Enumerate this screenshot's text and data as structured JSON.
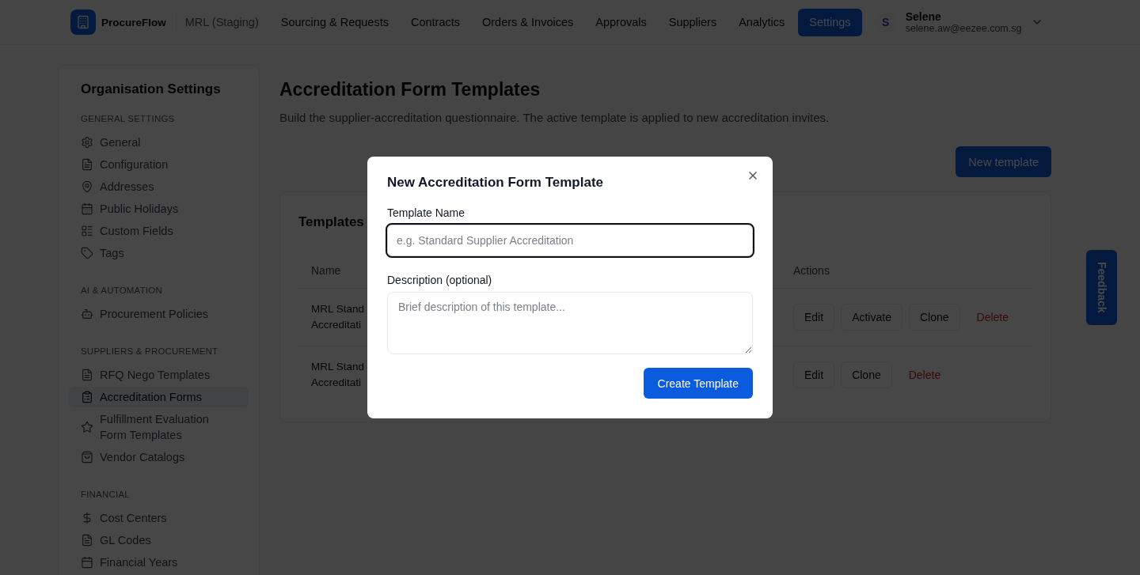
{
  "header": {
    "logo": "ProcureFlow",
    "workspace": "MRL (Staging)",
    "nav": [
      {
        "label": "Sourcing & Requests",
        "selected": false
      },
      {
        "label": "Contracts",
        "selected": false
      },
      {
        "label": "Orders & Invoices",
        "selected": false
      },
      {
        "label": "Approvals",
        "selected": false
      },
      {
        "label": "Suppliers",
        "selected": false
      },
      {
        "label": "Analytics",
        "selected": false
      },
      {
        "label": "Settings",
        "selected": true
      }
    ],
    "user": {
      "initial": "S",
      "name": "Selene",
      "email": "selene.aw@eezee.com.sg"
    }
  },
  "sidebar": {
    "title": "Organisation Settings",
    "sections": [
      {
        "heading": "GENERAL SETTINGS",
        "items": [
          {
            "label": "General",
            "selected": false
          },
          {
            "label": "Configuration",
            "selected": false
          },
          {
            "label": "Addresses",
            "selected": false
          },
          {
            "label": "Public Holidays",
            "selected": false
          },
          {
            "label": "Custom Fields",
            "selected": false
          },
          {
            "label": "Tags",
            "selected": false
          }
        ]
      },
      {
        "heading": "AI & AUTOMATION",
        "items": [
          {
            "label": "Procurement Policies",
            "selected": false
          }
        ]
      },
      {
        "heading": "SUPPLIERS & PROCUREMENT",
        "items": [
          {
            "label": "RFQ Nego Templates",
            "selected": false
          },
          {
            "label": "Accreditation Forms",
            "selected": true
          },
          {
            "label": "Fulfillment Evaluation Form Templates",
            "selected": false
          },
          {
            "label": "Vendor Catalogs",
            "selected": false
          }
        ]
      },
      {
        "heading": "FINANCIAL",
        "items": [
          {
            "label": "Cost Centers",
            "selected": false
          },
          {
            "label": "GL Codes",
            "selected": false
          },
          {
            "label": "Financial Years",
            "selected": false
          }
        ]
      }
    ]
  },
  "page": {
    "title": "Accreditation Form Templates",
    "subtitle": "Build the supplier-accreditation questionnaire. The active template is applied to new accreditation invites.",
    "primary_button": "New template",
    "card": {
      "title": "Templates",
      "columns": [
        "Name",
        "Actions"
      ],
      "rows": [
        {
          "name": "MRL Stand Accreditati",
          "actions": [
            {
              "label": "Edit",
              "kind": "default"
            },
            {
              "label": "Activate",
              "kind": "default"
            },
            {
              "label": "Clone",
              "kind": "default"
            },
            {
              "label": "Delete",
              "kind": "danger"
            }
          ]
        },
        {
          "name": "MRL Stand Accreditati",
          "actions": [
            {
              "label": "Edit",
              "kind": "default"
            },
            {
              "label": "Clone",
              "kind": "default"
            },
            {
              "label": "Delete",
              "kind": "danger"
            }
          ]
        }
      ]
    }
  },
  "feedback_tab": {
    "label": "Feedback"
  },
  "modal": {
    "title": "New Accreditation Form Template",
    "fields": [
      {
        "kind": "input",
        "label": "Template Name",
        "placeholder": "e.g. Standard Supplier Accreditation",
        "focused": true
      },
      {
        "kind": "textarea",
        "label": "Description (optional)",
        "placeholder": "Brief description of this template...",
        "focused": false
      }
    ],
    "submit": "Create Template"
  }
}
